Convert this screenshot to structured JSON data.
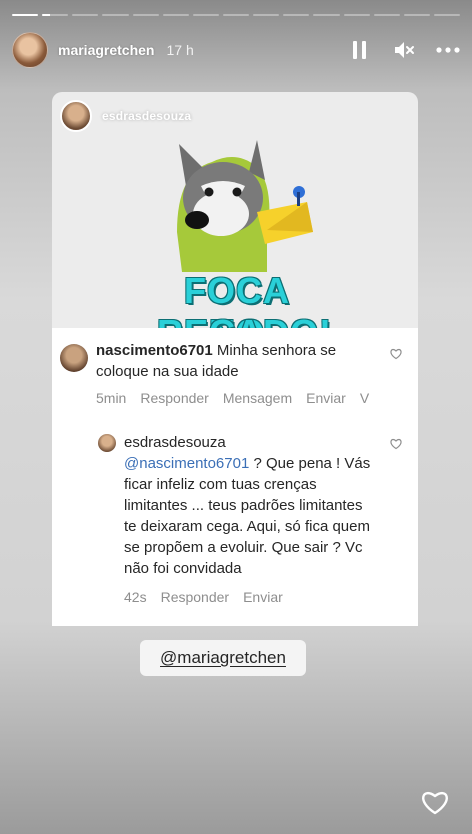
{
  "progress": [
    1,
    0.3,
    0,
    0,
    0,
    0,
    0,
    0,
    0,
    0,
    0,
    0,
    0,
    0,
    0
  ],
  "header": {
    "username": "mariagretchen",
    "time": "17 h"
  },
  "post": {
    "author": "esdrasdesouza",
    "sticker_line1": "FOCA NO",
    "sticker_line2": "RECADO!"
  },
  "comments": {
    "first": {
      "username": "nascimento6701",
      "text": "Minha senhora se coloque na sua idade",
      "age": "5min",
      "reply": "Responder",
      "message": "Mensagem",
      "send": "Enviar",
      "more": "V"
    },
    "second": {
      "username": "esdrasdesouza",
      "mention": "@nascimento6701",
      "text": "? Que pena ! Vás ficar infeliz com tuas crenças limitantes ... teus padrões limitantes te deixaram cega. Aqui, só fica quem se propõem a evoluir. Que sair ? Vc não foi convidada",
      "age": "42s",
      "reply": "Responder",
      "send": "Enviar"
    }
  },
  "mention_sticker": "@mariagretchen",
  "colors": {
    "mention": "#3b6fb6",
    "meta": "#8e8e8e",
    "sticker_text": "#2ad0d8"
  }
}
